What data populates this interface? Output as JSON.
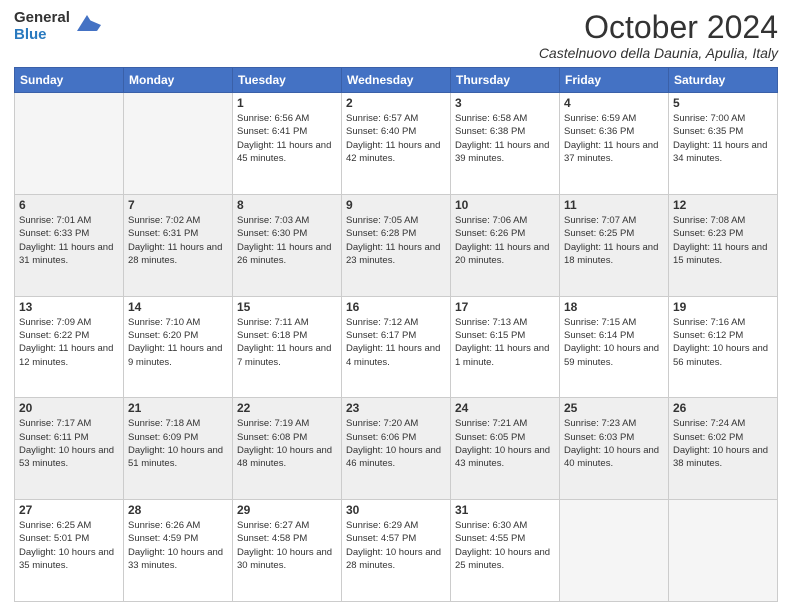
{
  "header": {
    "logo_line1": "General",
    "logo_line2": "Blue",
    "month_title": "October 2024",
    "location": "Castelnuovo della Daunia, Apulia, Italy"
  },
  "days_of_week": [
    "Sunday",
    "Monday",
    "Tuesday",
    "Wednesday",
    "Thursday",
    "Friday",
    "Saturday"
  ],
  "weeks": [
    [
      {
        "day": "",
        "sunrise": "",
        "sunset": "",
        "daylight": ""
      },
      {
        "day": "",
        "sunrise": "",
        "sunset": "",
        "daylight": ""
      },
      {
        "day": "1",
        "sunrise": "Sunrise: 6:56 AM",
        "sunset": "Sunset: 6:41 PM",
        "daylight": "Daylight: 11 hours and 45 minutes."
      },
      {
        "day": "2",
        "sunrise": "Sunrise: 6:57 AM",
        "sunset": "Sunset: 6:40 PM",
        "daylight": "Daylight: 11 hours and 42 minutes."
      },
      {
        "day": "3",
        "sunrise": "Sunrise: 6:58 AM",
        "sunset": "Sunset: 6:38 PM",
        "daylight": "Daylight: 11 hours and 39 minutes."
      },
      {
        "day": "4",
        "sunrise": "Sunrise: 6:59 AM",
        "sunset": "Sunset: 6:36 PM",
        "daylight": "Daylight: 11 hours and 37 minutes."
      },
      {
        "day": "5",
        "sunrise": "Sunrise: 7:00 AM",
        "sunset": "Sunset: 6:35 PM",
        "daylight": "Daylight: 11 hours and 34 minutes."
      }
    ],
    [
      {
        "day": "6",
        "sunrise": "Sunrise: 7:01 AM",
        "sunset": "Sunset: 6:33 PM",
        "daylight": "Daylight: 11 hours and 31 minutes."
      },
      {
        "day": "7",
        "sunrise": "Sunrise: 7:02 AM",
        "sunset": "Sunset: 6:31 PM",
        "daylight": "Daylight: 11 hours and 28 minutes."
      },
      {
        "day": "8",
        "sunrise": "Sunrise: 7:03 AM",
        "sunset": "Sunset: 6:30 PM",
        "daylight": "Daylight: 11 hours and 26 minutes."
      },
      {
        "day": "9",
        "sunrise": "Sunrise: 7:05 AM",
        "sunset": "Sunset: 6:28 PM",
        "daylight": "Daylight: 11 hours and 23 minutes."
      },
      {
        "day": "10",
        "sunrise": "Sunrise: 7:06 AM",
        "sunset": "Sunset: 6:26 PM",
        "daylight": "Daylight: 11 hours and 20 minutes."
      },
      {
        "day": "11",
        "sunrise": "Sunrise: 7:07 AM",
        "sunset": "Sunset: 6:25 PM",
        "daylight": "Daylight: 11 hours and 18 minutes."
      },
      {
        "day": "12",
        "sunrise": "Sunrise: 7:08 AM",
        "sunset": "Sunset: 6:23 PM",
        "daylight": "Daylight: 11 hours and 15 minutes."
      }
    ],
    [
      {
        "day": "13",
        "sunrise": "Sunrise: 7:09 AM",
        "sunset": "Sunset: 6:22 PM",
        "daylight": "Daylight: 11 hours and 12 minutes."
      },
      {
        "day": "14",
        "sunrise": "Sunrise: 7:10 AM",
        "sunset": "Sunset: 6:20 PM",
        "daylight": "Daylight: 11 hours and 9 minutes."
      },
      {
        "day": "15",
        "sunrise": "Sunrise: 7:11 AM",
        "sunset": "Sunset: 6:18 PM",
        "daylight": "Daylight: 11 hours and 7 minutes."
      },
      {
        "day": "16",
        "sunrise": "Sunrise: 7:12 AM",
        "sunset": "Sunset: 6:17 PM",
        "daylight": "Daylight: 11 hours and 4 minutes."
      },
      {
        "day": "17",
        "sunrise": "Sunrise: 7:13 AM",
        "sunset": "Sunset: 6:15 PM",
        "daylight": "Daylight: 11 hours and 1 minute."
      },
      {
        "day": "18",
        "sunrise": "Sunrise: 7:15 AM",
        "sunset": "Sunset: 6:14 PM",
        "daylight": "Daylight: 10 hours and 59 minutes."
      },
      {
        "day": "19",
        "sunrise": "Sunrise: 7:16 AM",
        "sunset": "Sunset: 6:12 PM",
        "daylight": "Daylight: 10 hours and 56 minutes."
      }
    ],
    [
      {
        "day": "20",
        "sunrise": "Sunrise: 7:17 AM",
        "sunset": "Sunset: 6:11 PM",
        "daylight": "Daylight: 10 hours and 53 minutes."
      },
      {
        "day": "21",
        "sunrise": "Sunrise: 7:18 AM",
        "sunset": "Sunset: 6:09 PM",
        "daylight": "Daylight: 10 hours and 51 minutes."
      },
      {
        "day": "22",
        "sunrise": "Sunrise: 7:19 AM",
        "sunset": "Sunset: 6:08 PM",
        "daylight": "Daylight: 10 hours and 48 minutes."
      },
      {
        "day": "23",
        "sunrise": "Sunrise: 7:20 AM",
        "sunset": "Sunset: 6:06 PM",
        "daylight": "Daylight: 10 hours and 46 minutes."
      },
      {
        "day": "24",
        "sunrise": "Sunrise: 7:21 AM",
        "sunset": "Sunset: 6:05 PM",
        "daylight": "Daylight: 10 hours and 43 minutes."
      },
      {
        "day": "25",
        "sunrise": "Sunrise: 7:23 AM",
        "sunset": "Sunset: 6:03 PM",
        "daylight": "Daylight: 10 hours and 40 minutes."
      },
      {
        "day": "26",
        "sunrise": "Sunrise: 7:24 AM",
        "sunset": "Sunset: 6:02 PM",
        "daylight": "Daylight: 10 hours and 38 minutes."
      }
    ],
    [
      {
        "day": "27",
        "sunrise": "Sunrise: 6:25 AM",
        "sunset": "Sunset: 5:01 PM",
        "daylight": "Daylight: 10 hours and 35 minutes."
      },
      {
        "day": "28",
        "sunrise": "Sunrise: 6:26 AM",
        "sunset": "Sunset: 4:59 PM",
        "daylight": "Daylight: 10 hours and 33 minutes."
      },
      {
        "day": "29",
        "sunrise": "Sunrise: 6:27 AM",
        "sunset": "Sunset: 4:58 PM",
        "daylight": "Daylight: 10 hours and 30 minutes."
      },
      {
        "day": "30",
        "sunrise": "Sunrise: 6:29 AM",
        "sunset": "Sunset: 4:57 PM",
        "daylight": "Daylight: 10 hours and 28 minutes."
      },
      {
        "day": "31",
        "sunrise": "Sunrise: 6:30 AM",
        "sunset": "Sunset: 4:55 PM",
        "daylight": "Daylight: 10 hours and 25 minutes."
      },
      {
        "day": "",
        "sunrise": "",
        "sunset": "",
        "daylight": ""
      },
      {
        "day": "",
        "sunrise": "",
        "sunset": "",
        "daylight": ""
      }
    ]
  ]
}
